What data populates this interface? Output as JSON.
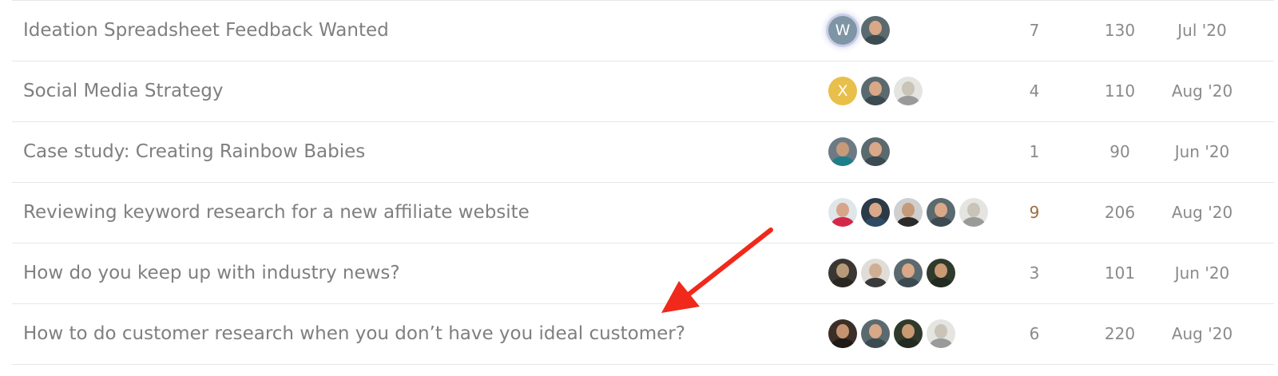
{
  "topics": [
    {
      "title": "Ideation Spreadsheet Feedback Wanted",
      "replies": "7",
      "views": "130",
      "activity": "Jul '20",
      "hot": false,
      "posters": [
        {
          "kind": "letter",
          "letter": "W",
          "bg": "#7e95a6",
          "glow": true
        },
        {
          "kind": "photo",
          "bg": "#5a6a6f",
          "skin": "#d9a888",
          "shirt": "#3c4a52"
        }
      ]
    },
    {
      "title": "Social Media Strategy",
      "replies": "4",
      "views": "110",
      "activity": "Aug '20",
      "hot": false,
      "posters": [
        {
          "kind": "letter",
          "letter": "X",
          "bg": "#e8bf4a"
        },
        {
          "kind": "photo",
          "bg": "#5a6a6f",
          "skin": "#d9a888",
          "shirt": "#3c4a52"
        },
        {
          "kind": "photo",
          "bg": "#e4e4e0",
          "skin": "#c9c3b8",
          "shirt": "#9a9a9a"
        }
      ]
    },
    {
      "title": "Case study: Creating Rainbow Babies",
      "replies": "1",
      "views": "90",
      "activity": "Jun '20",
      "hot": false,
      "posters": [
        {
          "kind": "photo",
          "bg": "#6c7a86",
          "skin": "#c79a7a",
          "shirt": "#1d7f8a"
        },
        {
          "kind": "photo",
          "bg": "#5a6a6f",
          "skin": "#d9a888",
          "shirt": "#3c4a52"
        }
      ]
    },
    {
      "title": "Reviewing keyword research for a new affiliate website",
      "replies": "9",
      "views": "206",
      "activity": "Aug '20",
      "hot": true,
      "posters": [
        {
          "kind": "photo",
          "bg": "#dfe6ea",
          "skin": "#d7a58a",
          "shirt": "#d4284a"
        },
        {
          "kind": "photo",
          "bg": "#2a3a46",
          "skin": "#d9a888",
          "shirt": "#2f4a63"
        },
        {
          "kind": "photo",
          "bg": "#cfcfcf",
          "skin": "#c49a78",
          "shirt": "#2b2b2b"
        },
        {
          "kind": "photo",
          "bg": "#5a6a6f",
          "skin": "#d9a888",
          "shirt": "#3c4a52"
        },
        {
          "kind": "photo",
          "bg": "#e4e4e0",
          "skin": "#c9c3b8",
          "shirt": "#9a9a9a"
        }
      ]
    },
    {
      "title": "How do you keep up with industry news?",
      "replies": "3",
      "views": "101",
      "activity": "Jun '20",
      "hot": false,
      "posters": [
        {
          "kind": "photo",
          "bg": "#3a3632",
          "skin": "#b89a7a",
          "shirt": "#2a2622"
        },
        {
          "kind": "photo",
          "bg": "#e0ddd8",
          "skin": "#cfae94",
          "shirt": "#3a3a3a"
        },
        {
          "kind": "photo",
          "bg": "#5a6a6f",
          "skin": "#d9a888",
          "shirt": "#3c4a52"
        },
        {
          "kind": "photo",
          "bg": "#2f3a2c",
          "skin": "#c99a74",
          "shirt": "#222a22"
        }
      ]
    },
    {
      "title": "How to do customer research when you don’t have you ideal customer?",
      "replies": "6",
      "views": "220",
      "activity": "Aug '20",
      "hot": false,
      "posters": [
        {
          "kind": "photo",
          "bg": "#3b2f28",
          "skin": "#c49470",
          "shirt": "#1f1a16"
        },
        {
          "kind": "photo",
          "bg": "#5a6a6f",
          "skin": "#d9a888",
          "shirt": "#3c4a52"
        },
        {
          "kind": "photo",
          "bg": "#2f3a2c",
          "skin": "#c99a74",
          "shirt": "#222a22"
        },
        {
          "kind": "photo",
          "bg": "#e4e4e0",
          "skin": "#c9c3b8",
          "shirt": "#9a9a9a"
        }
      ]
    }
  ],
  "colors": {
    "arrow": "#f0291b",
    "row_border": "#e6e6e6",
    "hot_replies": "#9e6e3f"
  }
}
